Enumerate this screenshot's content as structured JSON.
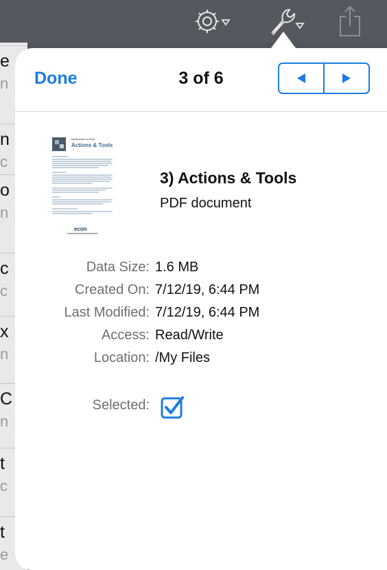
{
  "toolbar": {
    "gear_icon": "gear-icon",
    "wrench_icon": "wrench-icon",
    "share_icon": "share-icon"
  },
  "background_list": {
    "rows": [
      {
        "l1": "e",
        "l2": "n"
      },
      {
        "l1": "n",
        "l2": "c"
      },
      {
        "l1": "o",
        "l2": "n"
      },
      {
        "l1": "c",
        "l2": "c"
      },
      {
        "l1": "x",
        "l2": "n"
      },
      {
        "l1": "C",
        "l2": "n"
      },
      {
        "l1": "t",
        "l2": "c"
      },
      {
        "l1": "t",
        "l2": "e"
      }
    ]
  },
  "popover": {
    "done_label": "Done",
    "counter": "3 of 6",
    "prev_icon": "triangle-left-icon",
    "next_icon": "triangle-right-icon"
  },
  "document": {
    "thumbnail": {
      "heading_small": "Intellectual for iPad",
      "heading": "Actions & Tools",
      "logo_text": "econ"
    },
    "title": "3) Actions & Tools",
    "type": "PDF document"
  },
  "info": [
    {
      "label": "Data Size:",
      "value": "1.6 MB"
    },
    {
      "label": "Created On:",
      "value": "7/12/19, 6:44 PM"
    },
    {
      "label": "Last Modified:",
      "value": "7/12/19, 6:44 PM"
    },
    {
      "label": "Access:",
      "value": "Read/Write"
    },
    {
      "label": "Location:",
      "value": "/My Files"
    }
  ],
  "selected": {
    "label": "Selected:",
    "checked": true
  },
  "colors": {
    "accent": "#1b7ce4",
    "toolbar": "#55585f",
    "label_gray": "#6e6e73"
  }
}
